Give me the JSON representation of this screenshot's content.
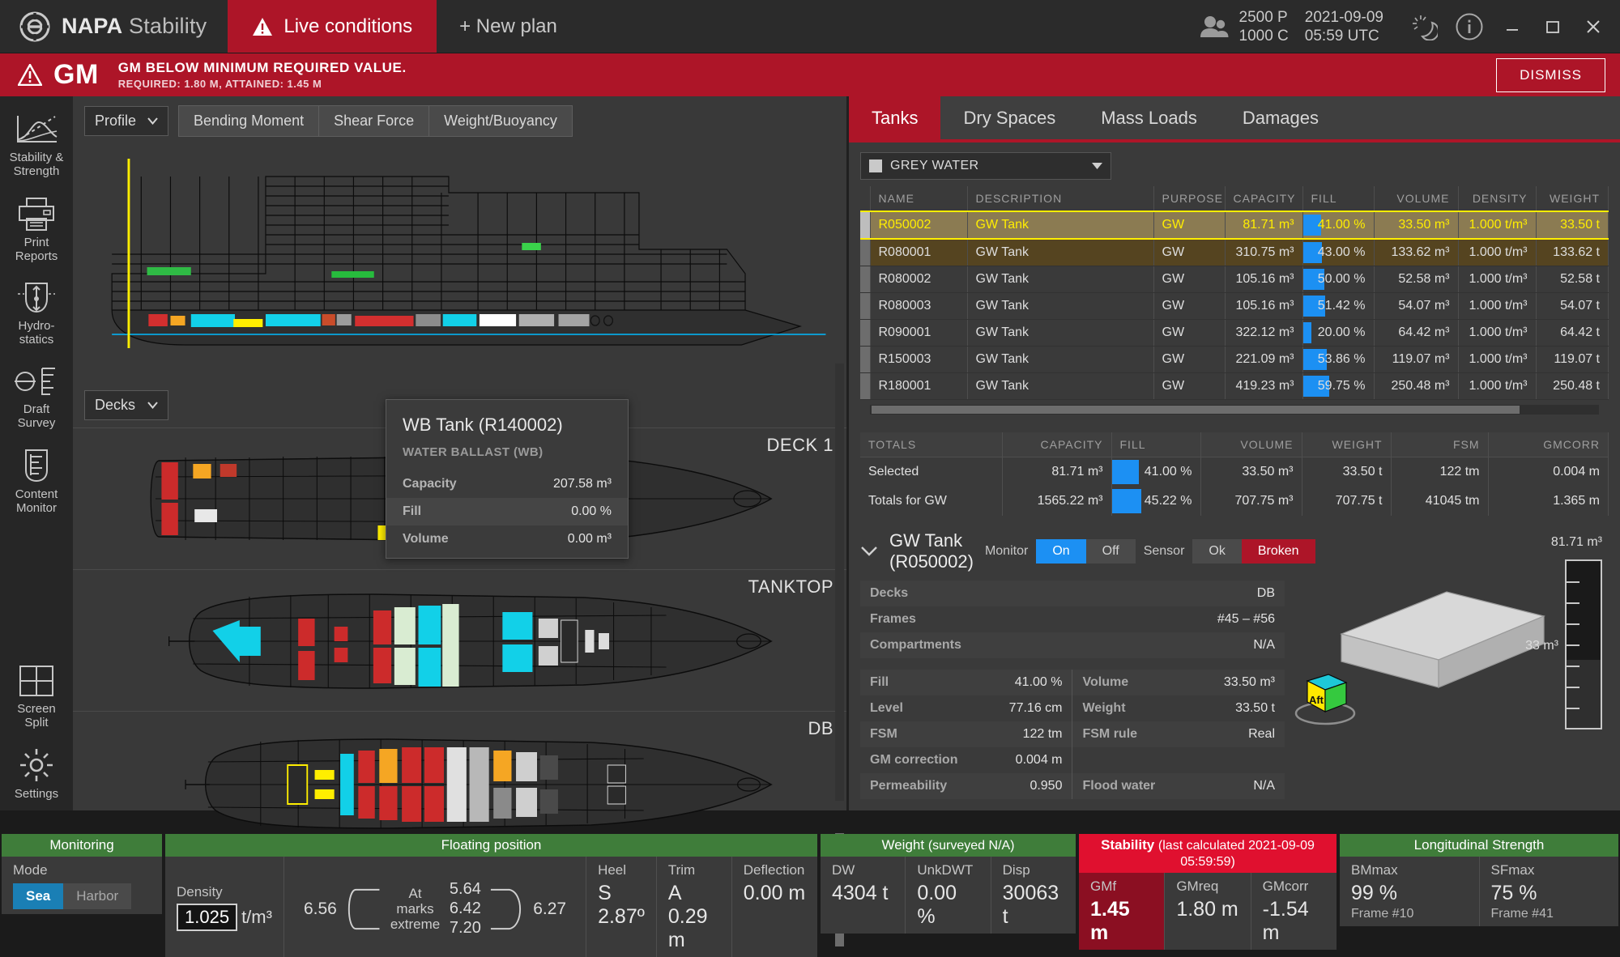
{
  "titlebar": {
    "brand_bold": "NAPA",
    "brand_light": " Stability",
    "tab_live": "Live conditions",
    "new_plan": "+ New plan",
    "pax_line1": "2500 P",
    "pax_line2": "1000 C",
    "date_line1": "2021-09-09",
    "date_line2": "05:59 UTC"
  },
  "alert": {
    "code": "GM",
    "line1": "GM BELOW MINIMUM REQUIRED VALUE.",
    "line2": "REQUIRED: 1.80 M, ATTAINED: 1.45 M",
    "dismiss": "DISMISS"
  },
  "rail": {
    "items": [
      {
        "label": "Stability &\nStrength",
        "icon": "stability-curve-icon"
      },
      {
        "label": "Print\nReports",
        "icon": "printer-icon"
      },
      {
        "label": "Hydro-\nstatics",
        "icon": "hydrostatics-icon"
      },
      {
        "label": "Draft\nSurvey",
        "icon": "draft-survey-icon"
      },
      {
        "label": "Content\nMonitor",
        "icon": "content-monitor-icon"
      },
      {
        "label": "Screen\nSplit",
        "icon": "screen-split-icon"
      },
      {
        "label": "Settings",
        "icon": "gear-icon"
      }
    ]
  },
  "center": {
    "view_select": "Profile",
    "buttons": [
      "Bending Moment",
      "Shear Force",
      "Weight/Buoyancy"
    ],
    "decks_select": "Decks",
    "deck_labels": [
      "DECK 1",
      "TANKTOP",
      "DB"
    ],
    "tooltip": {
      "title": "WB Tank (R140002)",
      "subtitle": "WATER BALLAST (WB)",
      "rows": [
        {
          "key": "Capacity",
          "value": "207.58 m³"
        },
        {
          "key": "Fill",
          "value": "0.00 %"
        },
        {
          "key": "Volume",
          "value": "0.00 m³"
        }
      ]
    }
  },
  "right": {
    "tabs": [
      {
        "label": "Tanks",
        "active": true
      },
      {
        "label": "Dry Spaces",
        "active": false
      },
      {
        "label": "Mass Loads",
        "active": false
      },
      {
        "label": "Damages",
        "active": false
      }
    ],
    "filter": "GREY WATER",
    "table": {
      "headers": [
        "NAME",
        "DESCRIPTION",
        "PURPOSE",
        "CAPACITY",
        "FILL",
        "VOLUME",
        "DENSITY",
        "WEIGHT"
      ],
      "rows": [
        {
          "name": "R050002",
          "description": "GW Tank",
          "purpose": "GW",
          "capacity": "81.71 m³",
          "fill": "41.00 %",
          "fill_pct": 41.0,
          "volume": "33.50 m³",
          "density": "1.000 t/m³",
          "weight": "33.50 t",
          "state": "selected"
        },
        {
          "name": "R080001",
          "description": "GW Tank",
          "purpose": "GW",
          "capacity": "310.75 m³",
          "fill": "43.00 %",
          "fill_pct": 43.0,
          "volume": "133.62 m³",
          "density": "1.000 t/m³",
          "weight": "133.62 t",
          "state": "highlight"
        },
        {
          "name": "R080002",
          "description": "GW Tank",
          "purpose": "GW",
          "capacity": "105.16 m³",
          "fill": "50.00 %",
          "fill_pct": 50.0,
          "volume": "52.58 m³",
          "density": "1.000 t/m³",
          "weight": "52.58 t",
          "state": ""
        },
        {
          "name": "R080003",
          "description": "GW Tank",
          "purpose": "GW",
          "capacity": "105.16 m³",
          "fill": "51.42 %",
          "fill_pct": 51.42,
          "volume": "54.07 m³",
          "density": "1.000 t/m³",
          "weight": "54.07 t",
          "state": ""
        },
        {
          "name": "R090001",
          "description": "GW Tank",
          "purpose": "GW",
          "capacity": "322.12 m³",
          "fill": "20.00 %",
          "fill_pct": 20.0,
          "volume": "64.42 m³",
          "density": "1.000 t/m³",
          "weight": "64.42 t",
          "state": ""
        },
        {
          "name": "R150003",
          "description": "GW Tank",
          "purpose": "GW",
          "capacity": "221.09 m³",
          "fill": "53.86 %",
          "fill_pct": 53.86,
          "volume": "119.07 m³",
          "density": "1.000 t/m³",
          "weight": "119.07 t",
          "state": ""
        },
        {
          "name": "R180001",
          "description": "GW Tank",
          "purpose": "GW",
          "capacity": "419.23 m³",
          "fill": "59.75 %",
          "fill_pct": 59.75,
          "volume": "250.48 m³",
          "density": "1.000 t/m³",
          "weight": "250.48 t",
          "state": ""
        }
      ]
    },
    "totals": {
      "headers": [
        "TOTALS",
        "CAPACITY",
        "FILL",
        "VOLUME",
        "WEIGHT",
        "FSM",
        "GMCORR"
      ],
      "rows": [
        {
          "label": "Selected",
          "capacity": "81.71 m³",
          "fill": "41.00 %",
          "fill_pct": 41.0,
          "volume": "33.50 m³",
          "weight": "33.50 t",
          "fsm": "122 tm",
          "gmcorr": "0.004 m"
        },
        {
          "label": "Totals for GW",
          "capacity": "1565.22 m³",
          "fill": "45.22 %",
          "fill_pct": 45.22,
          "volume": "707.75 m³",
          "weight": "707.75 t",
          "fsm": "41045 tm",
          "gmcorr": "1.365 m"
        }
      ]
    },
    "detail": {
      "title": "GW Tank (R050002)",
      "monitor_label": "Monitor",
      "monitor_on": "On",
      "monitor_off": "Off",
      "sensor_label": "Sensor",
      "sensor_ok": "Ok",
      "sensor_broken": "Broken",
      "top_rows": [
        {
          "key": "Decks",
          "value": "DB"
        },
        {
          "key": "Frames",
          "value": "#45 – #56"
        },
        {
          "key": "Compartments",
          "value": "N/A"
        }
      ],
      "grid_rows": [
        {
          "k1": "Fill",
          "v1": "41.00 %",
          "k2": "Volume",
          "v2": "33.50 m³"
        },
        {
          "k1": "Level",
          "v1": "77.16 cm",
          "k2": "Weight",
          "v2": "33.50 t"
        },
        {
          "k1": "FSM",
          "v1": "122 tm",
          "k2": "FSM rule",
          "v2": "Real"
        },
        {
          "k1": "GM correction",
          "v1": "0.004 m",
          "k2": "",
          "v2": ""
        },
        {
          "k1": "Permeability",
          "v1": "0.950",
          "k2": "Flood water",
          "v2": "N/A"
        }
      ],
      "gauge_top": "81.71 m³",
      "gauge_mid": "33 m³",
      "orientation_cube": "Aft"
    }
  },
  "status": {
    "monitoring": {
      "title": "Monitoring",
      "mode_label": "Mode",
      "sea": "Sea",
      "harbor": "Harbor"
    },
    "floating": {
      "title": "Floating position",
      "density_label": "Density",
      "density_value": "1.025",
      "density_unit": "t/m³",
      "mark_fwd": "6.56",
      "mark_aft": "6.27",
      "mark_top": "5.64",
      "mark_mid": "6.42",
      "mark_bot": "7.20",
      "marks_label": "At marks\nextreme",
      "cells": [
        {
          "key": "Heel",
          "value": "S 2.87º"
        },
        {
          "key": "Trim",
          "value": "A 0.29 m"
        },
        {
          "key": "Deflection",
          "value": "0.00 m"
        }
      ]
    },
    "weight": {
      "title": "Weight",
      "title_sub": "(surveyed N/A)",
      "cells": [
        {
          "key": "DW",
          "value": "4304 t"
        },
        {
          "key": "UnkDWT",
          "value": "0.00 %"
        },
        {
          "key": "Disp",
          "value": "30063 t"
        }
      ]
    },
    "stability": {
      "title": "Stability",
      "title_sub": "(last calculated 2021-09-09 05:59:59)",
      "cells": [
        {
          "key": "GMf",
          "value": "1.45  m",
          "highlight": true
        },
        {
          "key": "GMreq",
          "value": "1.80 m",
          "highlight": false
        },
        {
          "key": "GMcorr",
          "value": "-1.54 m",
          "highlight": false
        }
      ]
    },
    "longitudinal": {
      "title": "Longitudinal Strength",
      "cells": [
        {
          "key": "BMmax",
          "value": "99 %",
          "sub": "Frame #10"
        },
        {
          "key": "SFmax",
          "value": "75 %",
          "sub": "Frame #41"
        }
      ]
    }
  },
  "colors": {
    "accent_red": "#ad1528",
    "blue": "#1c90f3",
    "green": "#3f7d3a",
    "yellow": "#ffee00"
  }
}
